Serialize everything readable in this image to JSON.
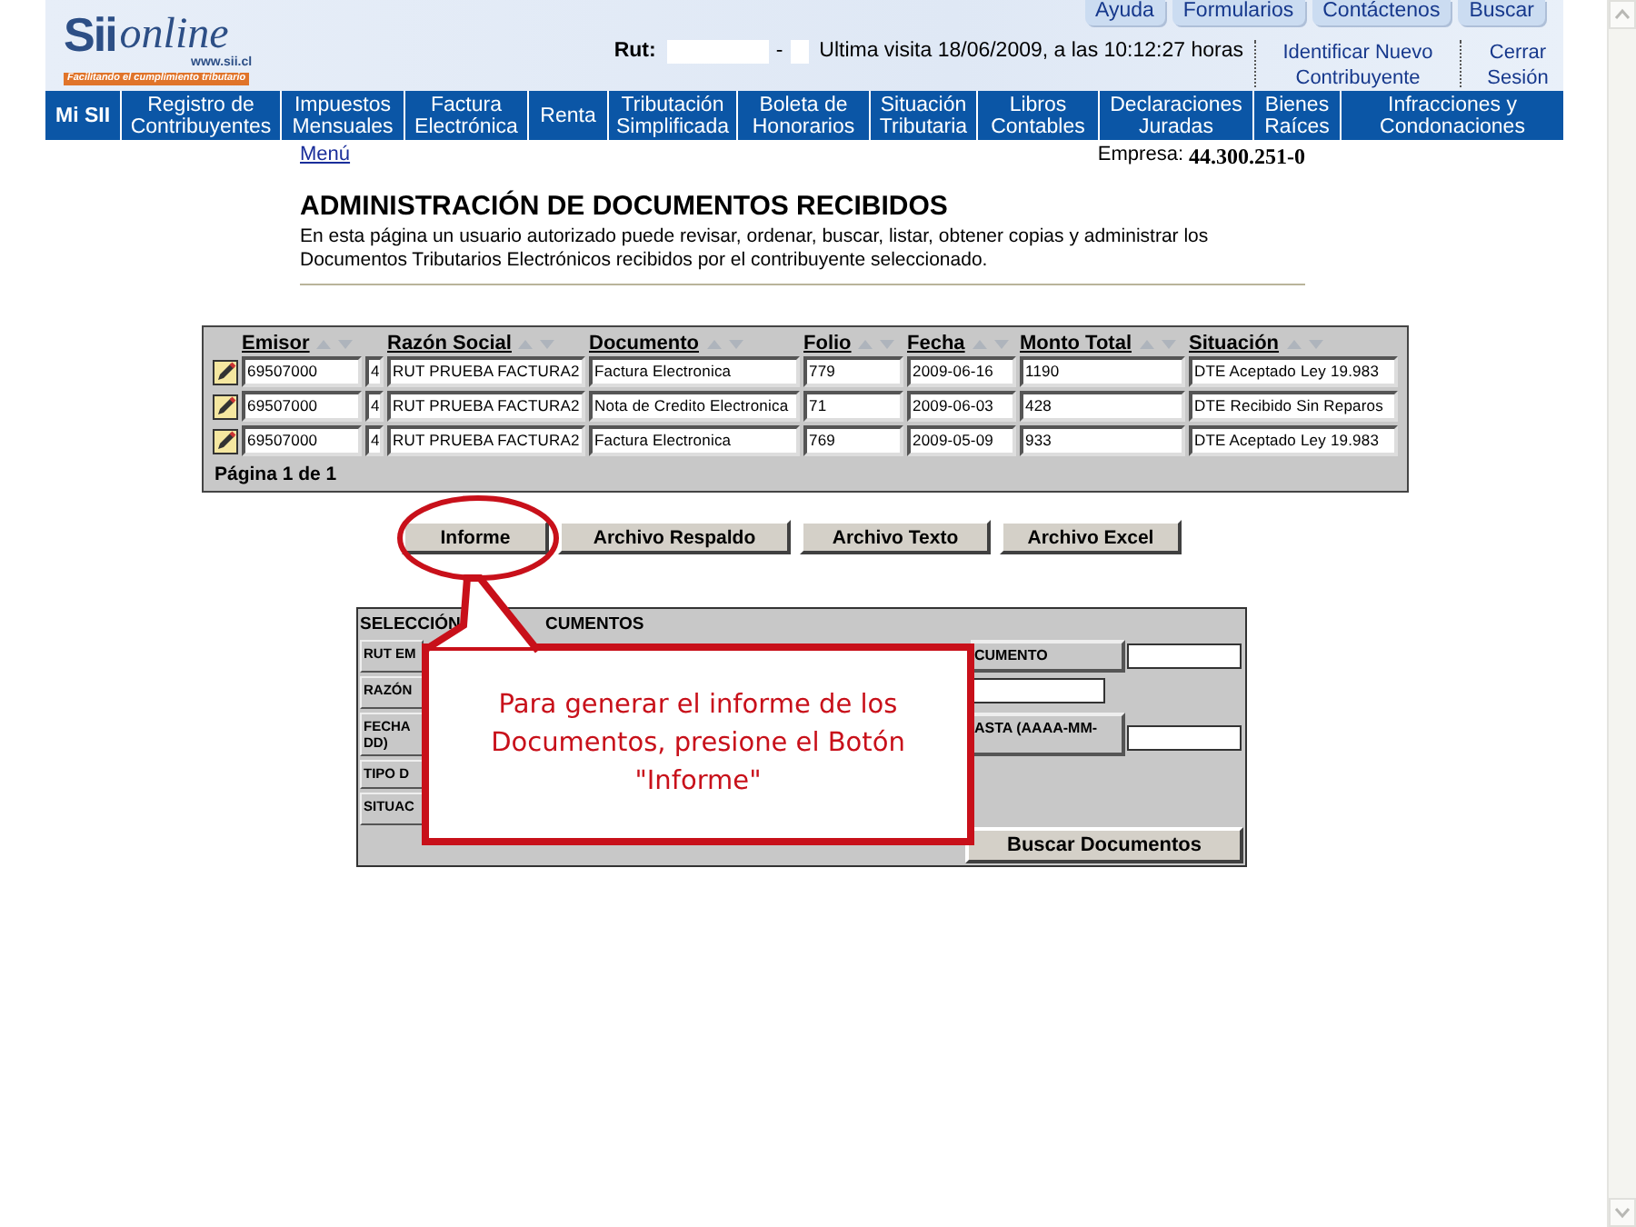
{
  "header": {
    "logo": {
      "brand": "Sii",
      "wordmark": "online",
      "url": "www.sii.cl",
      "tagline": "Facilitando el cumplimiento tributario"
    },
    "top_links": [
      "Ayuda",
      "Formularios",
      "Contáctenos",
      "Buscar"
    ],
    "rut_label": "Rut:",
    "rut_separator": "-",
    "last_visit": "Ultima visita 18/06/2009, a las 10:12:27 horas",
    "session_links": [
      "Identificar Nuevo Contribuyente",
      "Cerrar Sesión"
    ]
  },
  "nav": {
    "items": [
      {
        "label": "Mi SII",
        "selected": true
      },
      {
        "label": "Registro de Contribuyentes",
        "selected": false
      },
      {
        "label": "Impuestos Mensuales",
        "selected": false
      },
      {
        "label": "Factura Electrónica",
        "selected": false
      },
      {
        "label": "Renta",
        "selected": false
      },
      {
        "label": "Tributación Simplificada",
        "selected": false
      },
      {
        "label": "Boleta de Honorarios",
        "selected": false
      },
      {
        "label": "Situación Tributaria",
        "selected": false
      },
      {
        "label": "Libros Contables",
        "selected": false
      },
      {
        "label": "Declaraciones Juradas",
        "selected": false
      },
      {
        "label": "Bienes Raíces",
        "selected": false
      },
      {
        "label": "Infracciones y Condonaciones",
        "selected": false
      }
    ]
  },
  "menu_link": "Menú",
  "company_label": "Empresa:",
  "company_rut": "44.300.251-0",
  "page": {
    "title": "ADMINISTRACIÓN DE DOCUMENTOS RECIBIDOS",
    "description": "En esta página un usuario autorizado puede revisar, ordenar, buscar, listar, obtener copias y administrar los Documentos Tributarios Electrónicos recibidos por el contribuyente seleccionado."
  },
  "table": {
    "columns": [
      "Emisor",
      "Razón Social",
      "Documento",
      "Folio",
      "Fecha",
      "Monto Total",
      "Situación"
    ],
    "rows": [
      {
        "emisor": "69507000",
        "dv": "4",
        "razon_social": "RUT PRUEBA FACTURA2",
        "documento": "Factura Electronica",
        "folio": "779",
        "fecha": "2009-06-16",
        "monto_total": "1190",
        "situacion": "DTE Aceptado Ley 19.983"
      },
      {
        "emisor": "69507000",
        "dv": "4",
        "razon_social": "RUT PRUEBA FACTURA2",
        "documento": "Nota de Credito Electronica",
        "folio": "71",
        "fecha": "2009-06-03",
        "monto_total": "428",
        "situacion": "DTE Recibido Sin Reparos"
      },
      {
        "emisor": "69507000",
        "dv": "4",
        "razon_social": "RUT PRUEBA FACTURA2",
        "documento": "Factura Electronica",
        "folio": "769",
        "fecha": "2009-05-09",
        "monto_total": "933",
        "situacion": "DTE Aceptado Ley 19.983"
      }
    ],
    "pagination": "Página 1 de 1"
  },
  "actions": [
    "Informe",
    "Archivo Respaldo",
    "Archivo Texto",
    "Archivo Excel"
  ],
  "filter_panel": {
    "heading_start": "SELECCIÓN",
    "heading_end": "CUMENTOS",
    "left_labels": [
      [
        "RUT EM"
      ],
      [
        "RAZÓN"
      ],
      [
        "FECHA",
        "DD)"
      ],
      [
        "TIPO D"
      ],
      [
        "SITUAC"
      ]
    ],
    "right_labels": [
      "CUMENTO",
      "ASTA (AAAA-MM-"
    ],
    "search_button": "Buscar Documentos"
  },
  "callout": {
    "text": "Para generar el informe de los Documentos, presione el Botón \"Informe\""
  }
}
